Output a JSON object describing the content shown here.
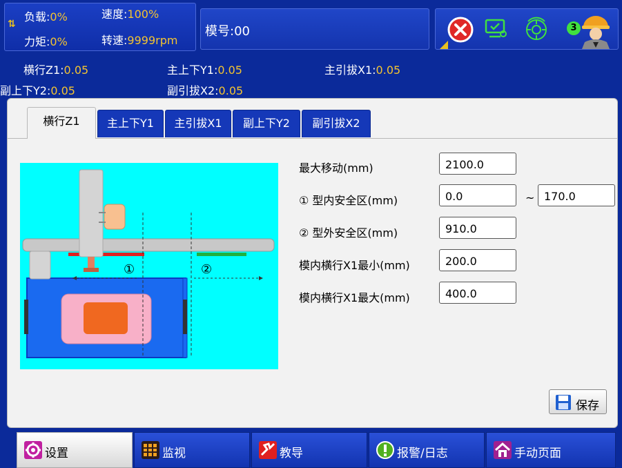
{
  "status": {
    "load_label": "负载:",
    "load_value": "0%",
    "speed_label": "速度:",
    "speed_value": "100%",
    "torque_label": "力矩:",
    "torque_value": "0%",
    "rpm_label": "转速:",
    "rpm_value": "9999rpm"
  },
  "model": {
    "label": "模号:00"
  },
  "user": {
    "badge": "3"
  },
  "axes": [
    {
      "label": "横行Z1:",
      "value": "0.05"
    },
    {
      "label": "主上下Y1:",
      "value": "0.05"
    },
    {
      "label": "主引拔X1:",
      "value": "0.05"
    },
    {
      "label": "副上下Y2:",
      "value": "0.05"
    },
    {
      "label": "副引拔X2:",
      "value": "0.05"
    }
  ],
  "tabs": [
    {
      "label": "横行Z1",
      "active": true
    },
    {
      "label": "主上下Y1",
      "active": false
    },
    {
      "label": "主引拔X1",
      "active": false
    },
    {
      "label": "副上下Y2",
      "active": false
    },
    {
      "label": "副引拔X2",
      "active": false
    }
  ],
  "diagram": {
    "zone1": "①",
    "zone2": "②"
  },
  "form": {
    "max_move_label": "最大移动(mm)",
    "max_move_value": "2100.0",
    "in_safe_label": "① 型内安全区(mm)",
    "in_safe_min": "0.0",
    "in_safe_sep": "~",
    "in_safe_max": "170.0",
    "out_safe_label": "② 型外安全区(mm)",
    "out_safe_value": "910.0",
    "x1_min_label": "模内横行X1最小(mm)",
    "x1_min_value": "200.0",
    "x1_max_label": "模内横行X1最大(mm)",
    "x1_max_value": "400.0"
  },
  "save_button": {
    "label": "保存"
  },
  "nav": [
    {
      "label": "设置",
      "icon": "gear-icon",
      "active": true
    },
    {
      "label": "监视",
      "icon": "monitor-icon",
      "active": false
    },
    {
      "label": "教导",
      "icon": "teach-icon",
      "active": false
    },
    {
      "label": "报警/日志",
      "icon": "alarm-icon",
      "active": false
    },
    {
      "label": "手动页面",
      "icon": "home-icon",
      "active": false
    }
  ],
  "colors": {
    "accent": "#0b2a9a",
    "value_yellow": "#f4c430",
    "diagram_bg": "#00ffff"
  }
}
